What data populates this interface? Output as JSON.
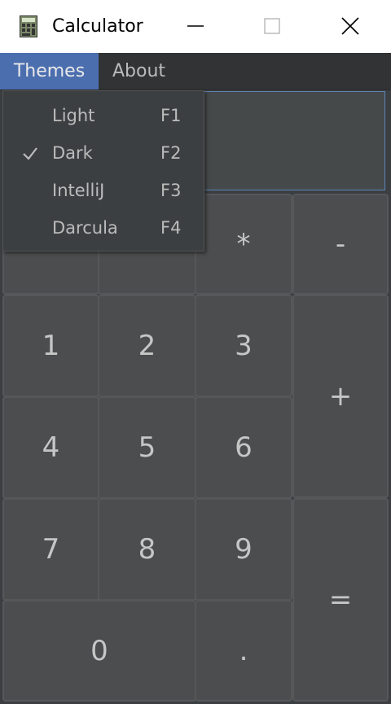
{
  "window": {
    "title": "Calculator",
    "controls": [
      "minimize",
      "maximize",
      "close"
    ]
  },
  "menubar": {
    "themes_label": "Themes",
    "about_label": "About"
  },
  "theme_menu": {
    "items": [
      {
        "label": "Light",
        "shortcut": "F1",
        "checked": false
      },
      {
        "label": "Dark",
        "shortcut": "F2",
        "checked": true
      },
      {
        "label": "IntelliJ",
        "shortcut": "F3",
        "checked": false
      },
      {
        "label": "Darcula",
        "shortcut": "F4",
        "checked": false
      }
    ]
  },
  "display": {
    "value": ""
  },
  "keys": {
    "multiply": "*",
    "minus": "-",
    "one": "1",
    "two": "2",
    "three": "3",
    "plus": "+",
    "four": "4",
    "five": "5",
    "six": "6",
    "seven": "7",
    "eight": "8",
    "nine": "9",
    "equals": "=",
    "zero": "0",
    "dot": "."
  },
  "colors": {
    "background": "#3c3f41",
    "menu_selected": "#4b6eaf",
    "key": "#4b4d4e",
    "display_border": "#5b84b6"
  }
}
